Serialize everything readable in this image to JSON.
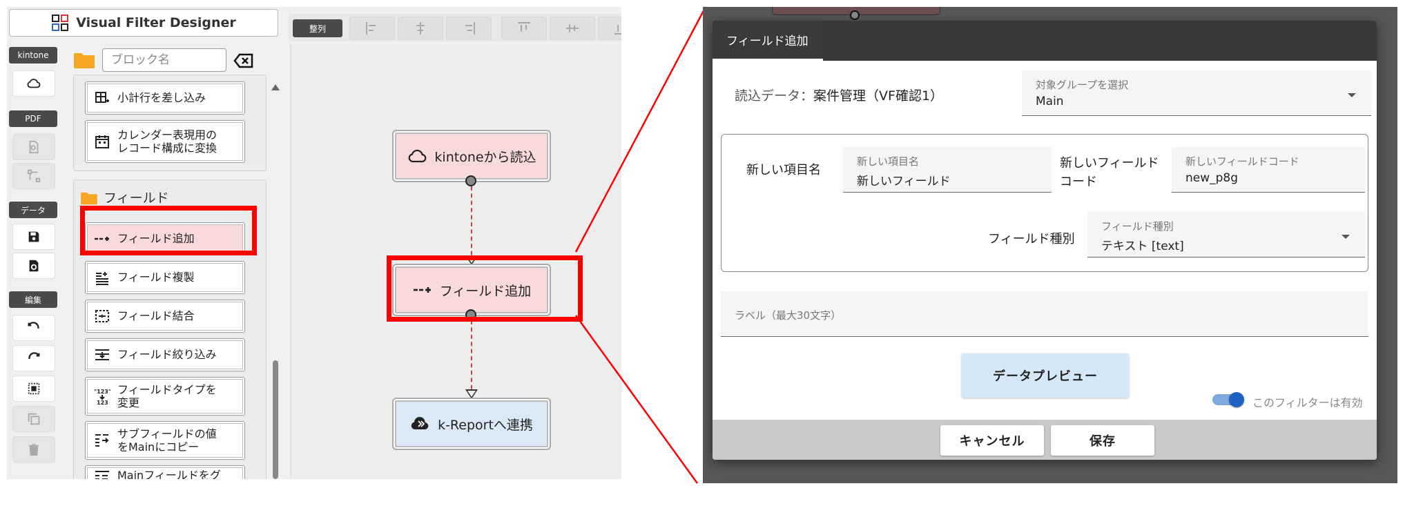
{
  "app": {
    "title": "Visual Filter Designer"
  },
  "sidebar": {
    "sections": [
      {
        "label": "kintone"
      },
      {
        "label": "PDF"
      },
      {
        "label": "データ"
      },
      {
        "label": "編集"
      }
    ]
  },
  "search": {
    "placeholder": "ブロック名",
    "value": ""
  },
  "palette": {
    "items_top": [
      {
        "label": "小計行を差し込み"
      },
      {
        "label": "カレンダー表現用の\nレコード構成に変換"
      }
    ],
    "fields_group_label": "フィールド",
    "items": [
      {
        "label": "フィールド追加",
        "selected": true
      },
      {
        "label": "フィールド複製"
      },
      {
        "label": "フィールド結合"
      },
      {
        "label": "フィールド絞り込み"
      },
      {
        "label": "フィールドタイプを\n変更"
      },
      {
        "label": "サブフィールドの値\nをMainにコピー"
      },
      {
        "label": "Mainフィールドをグ\nループに変換"
      }
    ]
  },
  "align_toolbar": {
    "label": "整列"
  },
  "canvas": {
    "nodes": [
      {
        "label": "kintoneから読込"
      },
      {
        "label": "フィールド追加"
      },
      {
        "label": "k-Reportへ連携"
      }
    ]
  },
  "dialog": {
    "tab": "フィールド追加",
    "read_data_prefix": "読込データ：",
    "read_data_value": "案件管理（VF確認1）",
    "target_group": {
      "label": "対象グループを選択",
      "value": "Main"
    },
    "new_item_name_label": "新しい項目名",
    "new_item_name_field": {
      "label": "新しい項目名",
      "value": "新しいフィールド"
    },
    "new_field_code_label_line1": "新しいフィールド",
    "new_field_code_label_line2": "コード",
    "new_field_code_field": {
      "label": "新しいフィールドコード",
      "value": "new_p8g"
    },
    "field_type_label": "フィールド種別",
    "field_type_field": {
      "label": "フィールド種別",
      "value": "テキスト [text]"
    },
    "label_field": {
      "placeholder": "ラベル（最大30文字）",
      "value": ""
    },
    "preview_button": "データプレビュー",
    "toggle_label": "このフィルターは有効",
    "toggle_on": true,
    "cancel_button": "キャンセル",
    "save_button": "保存"
  },
  "colors": {
    "highlight": "#ff0000",
    "node_read_bg": "#f8dada",
    "node_report_bg": "#dbe9f7",
    "toggle_on": "#1e63c4",
    "dialog_header": "#383838"
  }
}
